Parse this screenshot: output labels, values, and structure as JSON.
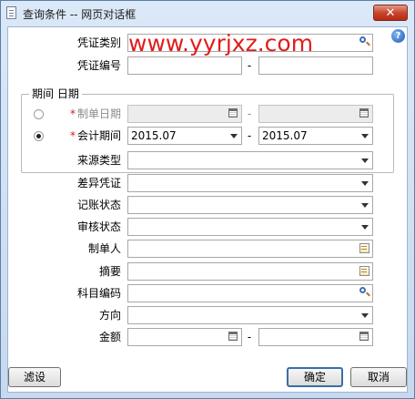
{
  "window": {
    "title": "查询条件 -- 网页对话框",
    "close_glyph": "✕"
  },
  "watermark": "www.yyrjxz.com",
  "fields": {
    "voucher_type": {
      "label": "凭证类别",
      "value": ""
    },
    "voucher_no": {
      "label": "凭证编号",
      "from": "",
      "to": "",
      "separator": "-"
    },
    "period_group": {
      "legend": "期间 日期",
      "make_date": {
        "label": "制单日期",
        "required_mark": "*",
        "from": "",
        "to": "",
        "separator": "-",
        "selected": false
      },
      "accounting_period": {
        "label": "会计期间",
        "required_mark": "*",
        "from": "2015.07",
        "to": "2015.07",
        "separator": "-",
        "selected": true
      }
    },
    "source_type": {
      "label": "来源类型",
      "value": ""
    },
    "diff_voucher": {
      "label": "差异凭证",
      "value": ""
    },
    "posting_status": {
      "label": "记账状态",
      "value": ""
    },
    "audit_status": {
      "label": "审核状态",
      "value": ""
    },
    "maker": {
      "label": "制单人",
      "value": ""
    },
    "summary": {
      "label": "摘要",
      "value": ""
    },
    "account_code": {
      "label": "科目编码",
      "value": ""
    },
    "direction": {
      "label": "方向",
      "value": ""
    },
    "amount": {
      "label": "金额",
      "from": "",
      "to": "",
      "separator": "-"
    }
  },
  "buttons": {
    "filter": "滤设",
    "ok": "确定",
    "cancel": "取消"
  },
  "help_glyph": "?",
  "colors": {
    "title_bg": "#c7d9ef",
    "close_red": "#c9452d",
    "required_star": "#d31a1a",
    "watermark": "#e11d1d"
  }
}
